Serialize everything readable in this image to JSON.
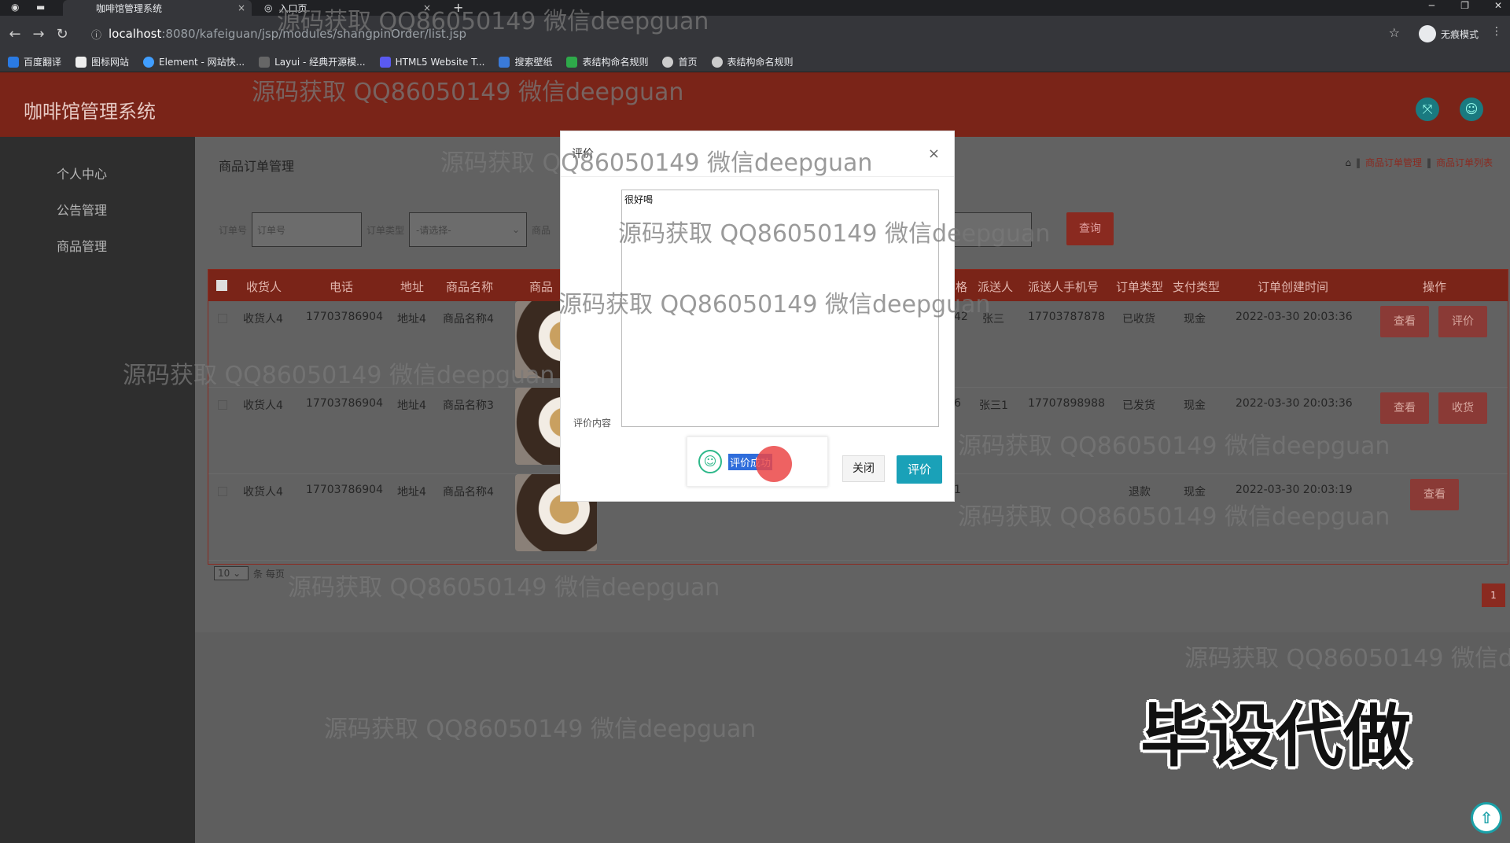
{
  "browser": {
    "tabs": [
      {
        "title": "咖啡馆管理系统",
        "close": "×"
      },
      {
        "title": "入口页",
        "close": "×"
      }
    ],
    "new_tab": "+",
    "url_host": "localhost",
    "url_path": ":8080/kafeiguan/jsp/modules/shangpinOrder/list.jsp",
    "incognito_label": "无痕模式",
    "bookmarks": [
      "百度翻译",
      "图标网站",
      "Element - 网站快...",
      "Layui - 经典开源模...",
      "HTML5 Website T...",
      "搜索壁纸",
      "表结构命名规则",
      "首页",
      "表结构命名规则"
    ]
  },
  "app": {
    "title": "咖啡馆管理系统",
    "sidebar": [
      "个人中心",
      "公告管理",
      "商品管理"
    ],
    "page_title": "商品订单管理",
    "breadcrumb": [
      "商品订单管理",
      "商品订单列表"
    ],
    "breadcrumb_sep": "‖",
    "search": {
      "order_no_label": "订单号",
      "order_no_placeholder": "订单号",
      "order_type_label": "订单类型",
      "order_type_value": "-请选择-",
      "product_label": "商品",
      "query_button": "查询"
    },
    "table": {
      "headers": [
        "收货人",
        "电话",
        "地址",
        "商品名称",
        "商品",
        "格",
        "派送人",
        "派送人手机号",
        "订单类型",
        "支付类型",
        "订单创建时间",
        "操作"
      ],
      "rows": [
        {
          "receiver": "收货人4",
          "phone": "17703786904",
          "address": "地址4",
          "product": "商品名称4",
          "qty": "42",
          "courier": "张三",
          "courier_phone": "17703787878",
          "order_type": "已收货",
          "pay_type": "现金",
          "created": "2022-03-30 20:03:36",
          "actions": [
            "查看",
            "评价"
          ]
        },
        {
          "receiver": "收货人4",
          "phone": "17703786904",
          "address": "地址4",
          "product": "商品名称3",
          "qty": "6",
          "courier": "张三1",
          "courier_phone": "17707898988",
          "order_type": "已发货",
          "pay_type": "现金",
          "created": "2022-03-30 20:03:36",
          "actions": [
            "查看",
            "收货"
          ]
        },
        {
          "receiver": "收货人4",
          "phone": "17703786904",
          "address": "地址4",
          "product": "商品名称4",
          "qty": "1",
          "courier": "",
          "courier_phone": "",
          "order_type": "退款",
          "pay_type": "现金",
          "created": "2022-03-30 20:03:19",
          "actions": [
            "查看"
          ]
        }
      ]
    },
    "pager": {
      "page_size": "10",
      "per_page_label": "条 每页",
      "current_page": "1"
    },
    "scroll_top": "⇧"
  },
  "modal": {
    "title": "评价",
    "close": "×",
    "content_label": "评价内容",
    "content_value": "很好喝",
    "toast": "评价成功",
    "close_button": "关闭",
    "submit_button": "评价"
  },
  "watermarks": {
    "text": "源码获取 QQ86050149 微信deepguan",
    "partial": "源码获取 QQ86050149 微信de",
    "big": "毕设代做"
  },
  "colors": {
    "header": "#7a2418",
    "accent": "#1aa1b8",
    "sidebar": "#2e2e2e"
  }
}
